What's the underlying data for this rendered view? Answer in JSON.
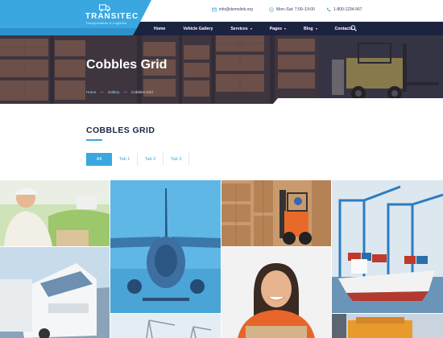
{
  "brand": {
    "title": "TRANSITEC",
    "subtitle": "Transportation & Logistics"
  },
  "contacts": [
    {
      "icon": "mail-icon",
      "text": "info@demolink.org"
    },
    {
      "icon": "clock-icon",
      "text": "Mon–Sat: 7:00–19:00"
    },
    {
      "icon": "phone-icon",
      "text": "1-800-1234-567"
    }
  ],
  "nav": [
    {
      "label": "Home",
      "has_caret": false
    },
    {
      "label": "Vehicle Gallery",
      "has_caret": false
    },
    {
      "label": "Services",
      "has_caret": true
    },
    {
      "label": "Pages",
      "has_caret": true
    },
    {
      "label": "Blog",
      "has_caret": true
    },
    {
      "label": "Contacts",
      "has_caret": false
    }
  ],
  "hero": {
    "title": "Cobbles Grid",
    "breadcrumbs": [
      "Home",
      "Gallery",
      "Cobbles Grid"
    ]
  },
  "section": {
    "title": "COBBLES GRID"
  },
  "tabs": [
    {
      "label": "All",
      "active": true
    },
    {
      "label": "Tab 1",
      "active": false
    },
    {
      "label": "Tab 2",
      "active": false
    },
    {
      "label": "Tab 3",
      "active": false
    }
  ],
  "colors": {
    "accent": "#3aa7e0",
    "navy": "#1c2340",
    "overlay": "#4db2e8"
  }
}
